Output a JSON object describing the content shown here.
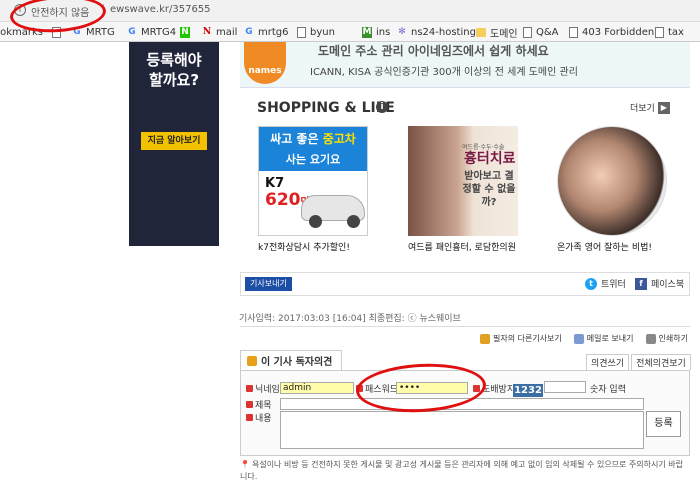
{
  "browser": {
    "security_label": "안전하지 않음",
    "url": "ewswave.kr/357655",
    "bookmarks": [
      {
        "label": "ookmarks",
        "icon": "none"
      },
      {
        "label": "",
        "icon": "doc-icon"
      },
      {
        "label": "MRTG",
        "icon": "google-icon"
      },
      {
        "label": "MRTG4",
        "icon": "google-icon"
      },
      {
        "label": "",
        "icon": "naver-icon"
      },
      {
        "label": "mail",
        "icon": "n-icon"
      },
      {
        "label": "mrtg6",
        "icon": "google-icon"
      },
      {
        "label": "byun",
        "icon": "doc-icon"
      },
      {
        "label": "ins",
        "icon": "m-icon"
      },
      {
        "label": "ns24-hosting",
        "icon": "dot-icon"
      },
      {
        "label": "도메인",
        "icon": "folder-icon"
      },
      {
        "label": "Q&A",
        "icon": "doc-icon"
      },
      {
        "label": "403 Forbidden",
        "icon": "doc-icon"
      },
      {
        "label": "tax",
        "icon": "doc-icon"
      }
    ]
  },
  "left_ad": {
    "text_line1": "등록해야",
    "text_line2": "할까요?",
    "button": "지금 알아보기"
  },
  "top_ad": {
    "logo": "names",
    "headline": "도메인 주소 관리 아이네임즈에서 쉽게 하세요",
    "sub": "ICANN, KISA 공식인증기관 300개 이상의 전 세계 도메인 관리"
  },
  "shopping": {
    "title": "SHOPPING & LIFE",
    "more": "더보기",
    "cards": [
      {
        "caption": "k7전화상담시 추가할인!",
        "line1a": "싸고 좋은 ",
        "line1b": "중고차",
        "line2": "사는 요기요",
        "model": "K7",
        "price": "620",
        "price_unit": "만원"
      },
      {
        "caption": "여드름 패인흉터, 로담한의원",
        "title": "흉터치료",
        "small": "여드름·수두·수술",
        "copy": "받아보고 결정할 수 없을까?"
      },
      {
        "caption": "온가족 영어 잘하는 비법!"
      }
    ]
  },
  "article": {
    "view_tag": "기사보내기",
    "twitter": "트위터",
    "facebook": "페이스북",
    "meta": "기사입력: 2017:03:03 [16:04]   최종편집: ⓒ 뉴스웨이브",
    "tools": [
      "필자의 다른기사보기",
      "메일로 보내기",
      "인쇄하기"
    ]
  },
  "comments": {
    "tab": "이 기사 독자의견",
    "right_tabs": [
      "의견쓰기",
      "전체의견보기"
    ],
    "name_label": "닉네임",
    "name_value": "admin",
    "pw_label": "패스워드",
    "pw_value": "••••",
    "spam_label": "도배방지",
    "captcha": "1232",
    "captcha_hint": "숫자 입력",
    "title_label": "제목",
    "body_label": "내용",
    "submit": "등록",
    "notice": "욕설이나 비방 등 건전하지 못한 게시물 및 광고성 게시물 등은 관리자에 의해 예고 없이 임의 삭제될 수 있으므로 주의하시기 바랍니다."
  }
}
